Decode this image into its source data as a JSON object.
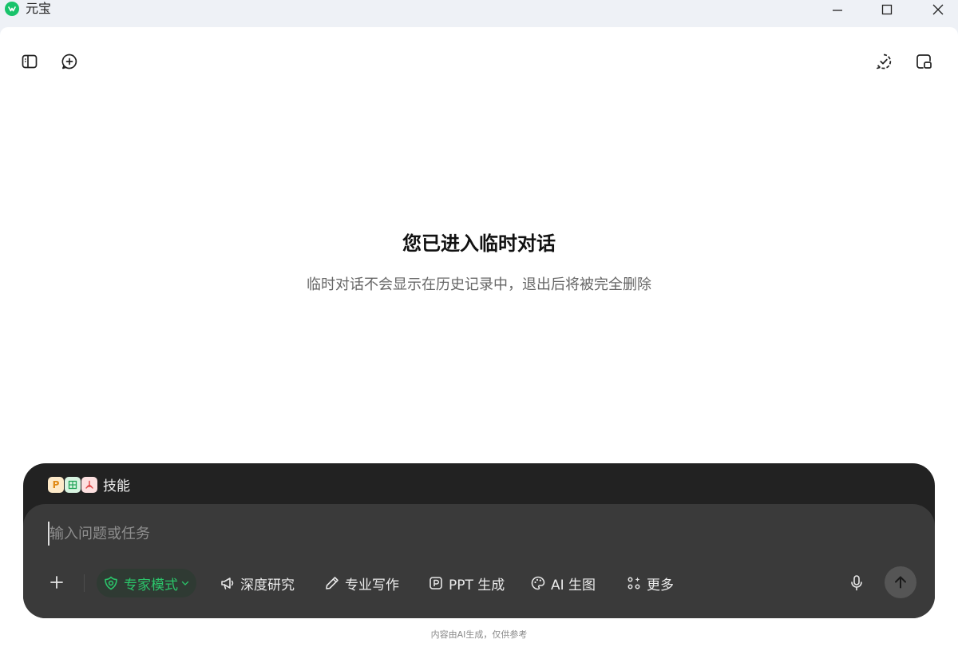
{
  "window": {
    "title": "元宝"
  },
  "main": {
    "headline": "您已进入临时对话",
    "subline": "临时对话不会显示在历史记录中，退出后将被完全删除"
  },
  "composer": {
    "skills_label": "技能",
    "skill_badges": [
      "P",
      "",
      ""
    ],
    "placeholder": "输入问题或任务",
    "chips": {
      "expert": "专家模式",
      "deep_research": "深度研究",
      "pro_writing": "专业写作",
      "ppt": "PPT 生成",
      "ai_image": "AI 生图",
      "more": "更多"
    }
  },
  "footer": {
    "note": "内容由AI生成，仅供参考"
  },
  "colors": {
    "accent": "#2bc46a",
    "composer_bg": "#3a3a3a",
    "composer_back": "#222222"
  }
}
